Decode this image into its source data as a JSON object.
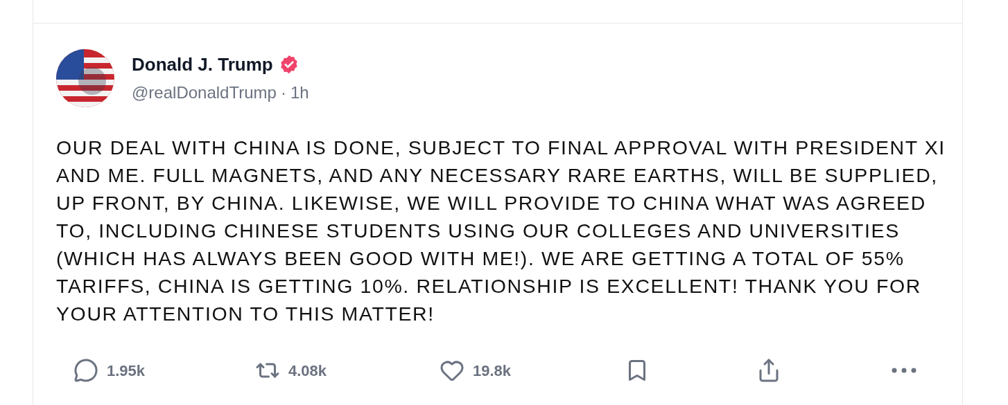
{
  "post": {
    "author": {
      "name": "Donald J. Trump",
      "verified": true,
      "handle": "@realDonaldTrump",
      "separator": "·",
      "time": "1h"
    },
    "text": "OUR DEAL WITH CHINA IS DONE, SUBJECT TO FINAL APPROVAL WITH PRESIDENT XI AND ME. FULL MAGNETS, AND ANY NECESSARY RARE EARTHS, WILL BE SUPPLIED, UP FRONT, BY CHINA. LIKEWISE, WE WILL PROVIDE TO CHINA WHAT WAS AGREED TO, INCLUDING CHINESE STUDENTS USING OUR COLLEGES AND UNIVERSITIES (WHICH HAS ALWAYS BEEN GOOD WITH ME!). WE ARE GETTING A TOTAL OF 55% TARIFFS, CHINA IS GETTING 10%. RELATIONSHIP IS EXCELLENT! THANK YOU FOR YOUR ATTENTION TO THIS MATTER!",
    "actions": [
      {
        "kind": "reply",
        "count": "1.95k"
      },
      {
        "kind": "repost",
        "count": "4.08k"
      },
      {
        "kind": "like",
        "count": "19.8k"
      },
      {
        "kind": "bookmark"
      },
      {
        "kind": "share"
      },
      {
        "kind": "more"
      }
    ]
  }
}
